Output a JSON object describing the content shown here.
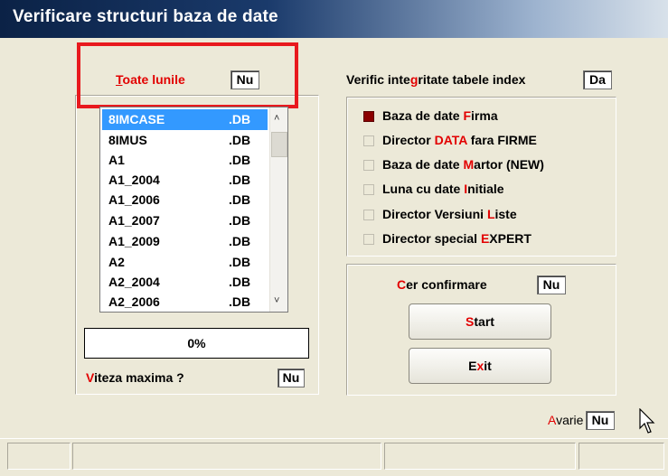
{
  "window": {
    "title": "Verificare structuri baza de date"
  },
  "toate_lunile": {
    "hotkey": "T",
    "rest": "oate lunile",
    "value": "Nu"
  },
  "integritate": {
    "pre": "Verific inte",
    "hotkey": "g",
    "post": "ritate tabele index",
    "value": "Da"
  },
  "files": [
    {
      "name": "8IMCASE",
      "ext": ".DB",
      "selected": true
    },
    {
      "name": "8IMUS",
      "ext": ".DB"
    },
    {
      "name": "A1",
      "ext": ".DB"
    },
    {
      "name": "A1_2004",
      "ext": ".DB"
    },
    {
      "name": "A1_2006",
      "ext": ".DB"
    },
    {
      "name": "A1_2007",
      "ext": ".DB"
    },
    {
      "name": "A1_2009",
      "ext": ".DB"
    },
    {
      "name": "A2",
      "ext": ".DB"
    },
    {
      "name": "A2_2004",
      "ext": ".DB"
    },
    {
      "name": "A2_2006",
      "ext": ".DB"
    }
  ],
  "progress": {
    "text": "0%"
  },
  "viteza": {
    "hotkey": "V",
    "rest": "iteza maxima ?",
    "value": "Nu"
  },
  "options": [
    {
      "pre": "Baza de date ",
      "hotkey": "F",
      "post": "irma",
      "checked": true
    },
    {
      "pre": "Director ",
      "hotkey": "DATA",
      "post": " fara FIRME",
      "checked": false
    },
    {
      "pre": "Baza de date ",
      "hotkey": "M",
      "post": "artor (NEW)",
      "checked": false
    },
    {
      "pre": "Luna cu date ",
      "hotkey": "I",
      "post": "nitiale",
      "checked": false
    },
    {
      "pre": "Director Versiuni ",
      "hotkey": "L",
      "post": "iste",
      "checked": false
    },
    {
      "pre": "Director special ",
      "hotkey": "E",
      "post": "XPERT",
      "checked": false
    }
  ],
  "cer_confirmare": {
    "hotkey": "C",
    "rest": "er confirmare",
    "value": "Nu"
  },
  "start_button": {
    "hotkey": "S",
    "rest": "tart"
  },
  "exit_button": {
    "pre": "E",
    "hotkey": "x",
    "post": "it"
  },
  "avarie": {
    "hotkey": "A",
    "rest": "varie",
    "value": "Nu"
  },
  "colors": {
    "hotkey": "#e20000",
    "highlight": "#e8191e",
    "selection": "#3399ff",
    "checked": "#8b0000"
  }
}
